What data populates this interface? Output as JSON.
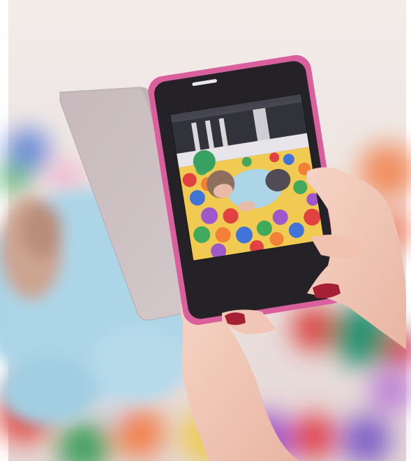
{
  "scene": {
    "subject_icons": [
      "phone-icon",
      "hand-icon",
      "ball-icon"
    ],
    "colors": {
      "wall": "#efe6e4",
      "case_pink": "#d95a9a",
      "flap": "#c9bcbf",
      "skin": "#f3c7b6",
      "nail": "#a2172d",
      "baby_shirt": "#a9d4e6"
    }
  }
}
